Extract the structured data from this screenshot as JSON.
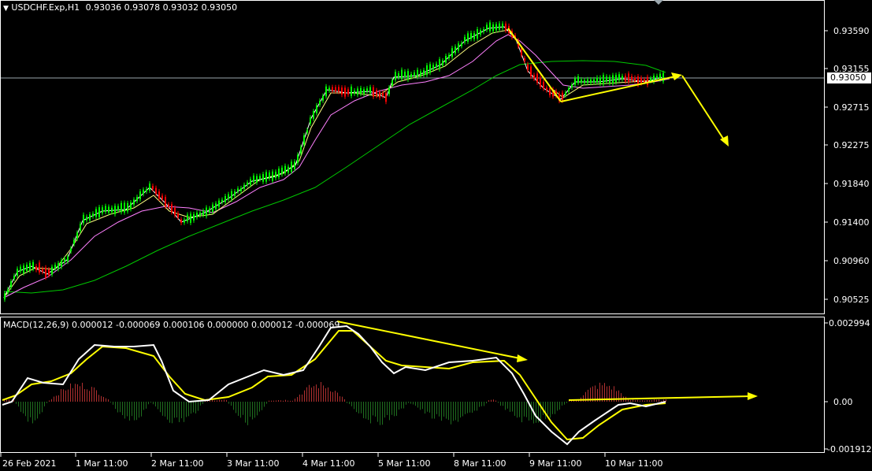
{
  "main_header": {
    "symbol": "USDCHF.Exp,H1",
    "ohlc": "0.93036 0.93078 0.93032 0.93050"
  },
  "macd_header": {
    "text": "MACD(12,26,9) 0.000012 -0.000069 0.000106 0.000000 0.000012 -0.000069"
  },
  "price_axis": [
    "0.93590",
    "0.93155",
    "0.92715",
    "0.92275",
    "0.91840",
    "0.91400",
    "0.90960",
    "0.90525"
  ],
  "current_price": "0.93050",
  "macd_axis": [
    "0.002994",
    "0.00",
    "-0.001912"
  ],
  "time_axis": [
    "26 Feb 2021",
    "1 Mar 11:00",
    "2 Mar 11:00",
    "3 Mar 11:00",
    "4 Mar 11:00",
    "5 Mar 11:00",
    "8 Mar 11:00",
    "9 Mar 11:00",
    "10 Mar 11:00"
  ],
  "colors": {
    "background": "#000000",
    "bull_candle": "#00ff00",
    "bear_candle": "#ff0000",
    "ma_fast": "#ffffff",
    "ma_mid": "#ffff80",
    "ma_slow": "#ff80ff",
    "ma_long": "#00c800",
    "macd_line": "#ffffff",
    "signal_line": "#ffff00",
    "hist_pos": "#b03030",
    "hist_neg": "#1f6e1f",
    "annotation": "#ffff00",
    "grid_frame": "#ffffff"
  },
  "icons": {
    "menu": "triangle-down-icon",
    "scroll_marker": "triangle-marker-icon"
  }
}
